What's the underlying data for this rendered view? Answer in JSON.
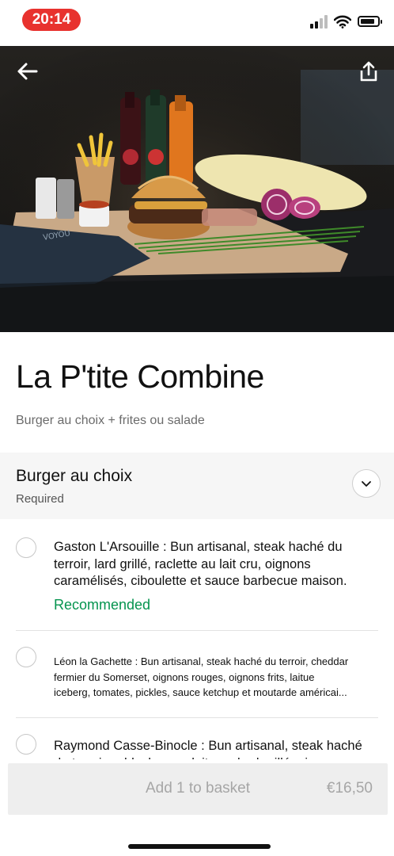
{
  "status_bar": {
    "time": "20:14",
    "icons": [
      "cellular-signal-icon",
      "wifi-icon",
      "battery-icon"
    ]
  },
  "hero": {
    "back_icon": "back-arrow-icon",
    "share_icon": "share-icon",
    "image_description_tag": "burger-fries-drinks-photo"
  },
  "product": {
    "title": "La P'tite Combine",
    "subtitle": "Burger au choix + frites ou salade"
  },
  "section": {
    "title": "Burger au choix",
    "required": "Required",
    "toggle_icon": "chevron-down-icon"
  },
  "options": [
    {
      "label": "Gaston L'Arsouille : Bun artisanal, steak haché du terroir, lard grillé, raclette au lait cru, oignons caramélisés, ciboulette et sauce barbecue maison.",
      "badge": "Recommended"
    },
    {
      "line1": "Léon la Gachette : Bun artisanal, steak haché du terroir, cheddar",
      "line2": "fermier du Somerset, oignons rouges, oignons frits, laitue",
      "line3": "iceberg, tomates, pickles, sauce ketchup et moutarde américai..."
    },
    {
      "label": "Raymond Casse-Binocle : Bun artisanal, steak haché du terroir, reblochon au lait cru, lard grillé, oignons"
    }
  ],
  "basket": {
    "label": "Add 1 to basket",
    "price": "€16,50"
  },
  "colors": {
    "time_pill": "#e8322e",
    "recommended": "#05944f",
    "button_bg": "#eeeeee",
    "button_text": "#a6a6a6"
  }
}
